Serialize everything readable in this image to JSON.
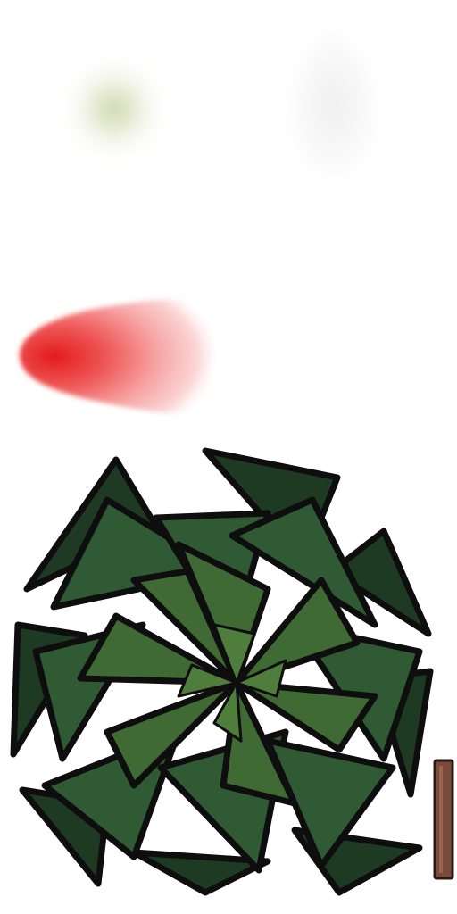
{
  "sprite_sheet": {
    "background": "#ffffff",
    "sprites": [
      {
        "id": "glow-soft-green",
        "icon": "soft-green-glow",
        "color": "#c9d2a6"
      },
      {
        "id": "glow-pale-cone",
        "icon": "pale-cone-glow",
        "color": "#ececec"
      },
      {
        "id": "red-flame-cone",
        "icon": "red-flame-cone",
        "color": "#e02020"
      },
      {
        "id": "bush-foliage",
        "icon": "leafy-bush-top-down",
        "colors": {
          "dark": "#1e3a22",
          "mid": "#2f5a33",
          "light": "#4f7d3b",
          "outline": "#0e0e0e"
        }
      },
      {
        "id": "wooden-stick",
        "icon": "wooden-stick",
        "color": "#7a4a3a"
      }
    ]
  }
}
